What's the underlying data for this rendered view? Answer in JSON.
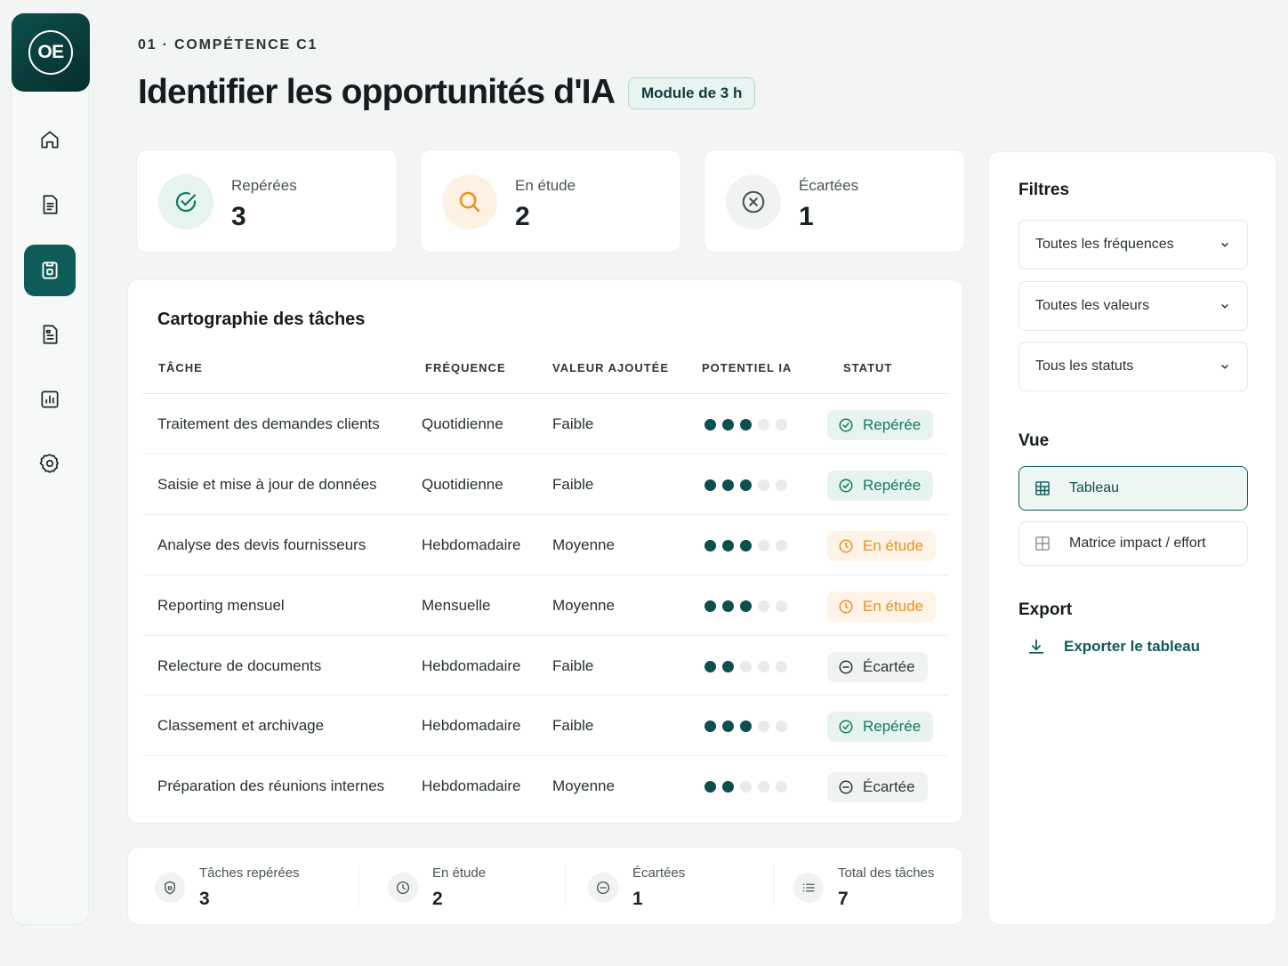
{
  "logo": {
    "initials": "OE"
  },
  "nav": [
    {
      "name": "home-icon"
    },
    {
      "name": "document-icon"
    },
    {
      "name": "module-icon",
      "active": true
    },
    {
      "name": "report-icon"
    },
    {
      "name": "chart-icon"
    },
    {
      "name": "settings-icon"
    }
  ],
  "header": {
    "eyebrow": "01 · COMPÉTENCE C1",
    "title": "Identifier les opportunités d'IA",
    "badge": "Module de 3 h"
  },
  "stats": [
    {
      "label": "Repérées",
      "value": "3",
      "icon": "check-target-icon",
      "color": "#137a62"
    },
    {
      "label": "En étude",
      "value": "2",
      "icon": "search-icon",
      "color": "#e8911e"
    },
    {
      "label": "Écartées",
      "value": "1",
      "icon": "x-circle-icon",
      "color": "#4a5356"
    }
  ],
  "table": {
    "title": "Cartographie des tâches",
    "headers": {
      "task": "TÂCHE",
      "frequency": "FRÉQUENCE",
      "value": "VALEUR AJOUTÉE",
      "potential": "POTENTIEL IA",
      "status": "STATUT"
    },
    "rows": [
      {
        "task": "Traitement des demandes clients",
        "frequency": "Quotidienne",
        "value": "Faible",
        "potential": 3,
        "status": "Repérée",
        "status_type": "rep"
      },
      {
        "task": "Saisie et mise à jour de données",
        "frequency": "Quotidienne",
        "value": "Faible",
        "potential": 3,
        "status": "Repérée",
        "status_type": "rep"
      },
      {
        "task": "Analyse des devis fournisseurs",
        "frequency": "Hebdomadaire",
        "value": "Moyenne",
        "potential": 3,
        "status": "En étude",
        "status_type": "etu"
      },
      {
        "task": "Reporting mensuel",
        "frequency": "Mensuelle",
        "value": "Moyenne",
        "potential": 3,
        "status": "En étude",
        "status_type": "etu"
      },
      {
        "task": "Relecture de documents",
        "frequency": "Hebdomadaire",
        "value": "Faible",
        "potential": 2,
        "status": "Écartée",
        "status_type": "eca"
      },
      {
        "task": "Classement et archivage",
        "frequency": "Hebdomadaire",
        "value": "Faible",
        "potential": 3,
        "status": "Repérée",
        "status_type": "rep"
      },
      {
        "task": "Préparation des réunions internes",
        "frequency": "Hebdomadaire",
        "value": "Moyenne",
        "potential": 2,
        "status": "Écartée",
        "status_type": "eca"
      }
    ],
    "potential_max": 5
  },
  "summary": [
    {
      "label": "Tâches repérées",
      "value": "3",
      "icon": "shield-icon"
    },
    {
      "label": "En étude",
      "value": "2",
      "icon": "clock-icon"
    },
    {
      "label": "Écartées",
      "value": "1",
      "icon": "minus-circle-icon"
    },
    {
      "label": "Total des tâches",
      "value": "7",
      "icon": "list-icon"
    }
  ],
  "filters": {
    "title": "Filtres",
    "selects": [
      "Toutes les fréquences",
      "Toutes les valeurs",
      "Tous les statuts"
    ],
    "view_title": "Vue",
    "views": [
      {
        "label": "Tableau",
        "active": true
      },
      {
        "label": "Matrice impact / effort",
        "active": false
      }
    ],
    "export_title": "Export",
    "export_label": "Exporter le tableau"
  },
  "colors": {
    "accent": "#0e5b57",
    "success": "#137a62",
    "warning": "#e8911e"
  }
}
